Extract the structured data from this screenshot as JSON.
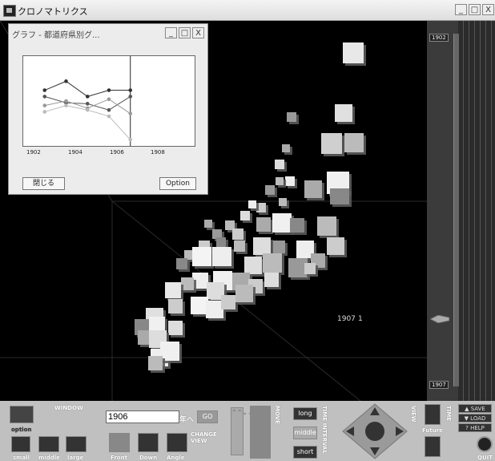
{
  "window": {
    "title": "クロノマトリクス",
    "btn_min": "_",
    "btn_max": "□",
    "btn_close": "X"
  },
  "graph_window": {
    "title": "グラフ - 都道府県別グ...",
    "x_ticks": [
      "1902",
      "1904",
      "1906",
      "1908"
    ],
    "close_label": "閉じる",
    "option_label": "Option"
  },
  "chart_data": {
    "type": "line",
    "x": [
      1902,
      1903,
      1904,
      1905,
      1906
    ],
    "series": [
      {
        "values": [
          0.62,
          0.72,
          0.55,
          0.62,
          0.62
        ]
      },
      {
        "values": [
          0.55,
          0.48,
          0.47,
          0.4,
          0.55
        ]
      },
      {
        "values": [
          0.45,
          0.5,
          0.42,
          0.52,
          0.36
        ]
      },
      {
        "values": [
          0.38,
          0.45,
          0.4,
          0.33,
          0.07
        ]
      }
    ],
    "cursor_x": 1906,
    "xlim": [
      1901,
      1909
    ],
    "ylim": [
      0,
      1
    ],
    "colors": [
      "#333333",
      "#555555",
      "#999999",
      "#bbbbbb"
    ]
  },
  "scene": {
    "year_label": "1907",
    "value_label": "1"
  },
  "timeline": {
    "top_year": "1902",
    "bottom_year": "1907"
  },
  "panel": {
    "window_label": "WINDOW",
    "option_label": "option",
    "small_label": "small",
    "middle_size_label": "middle",
    "large_label": "large",
    "year_value": "1906",
    "year_suffix": "年へ",
    "go_label": "GO",
    "change_view_label": "CHANGE VIEW",
    "front_label": "Front",
    "down_label": "Down",
    "angle_label": "Angle",
    "move_label": "MOVE",
    "long_label": "long",
    "middle_label": "middle",
    "short_label": "short",
    "time_interval_label": "TIME INTERVAL",
    "view_label": "VIEW",
    "time_label": "TIME",
    "future_label": "Future",
    "save_label": "▲ SAVE",
    "load_label": "▼ LOAD",
    "help_label": "? HELP",
    "quit_label": "QUIT"
  },
  "colors": {
    "panel": "#c0c0c0",
    "scene_bg": "#000000",
    "button_dark": "#333333"
  }
}
